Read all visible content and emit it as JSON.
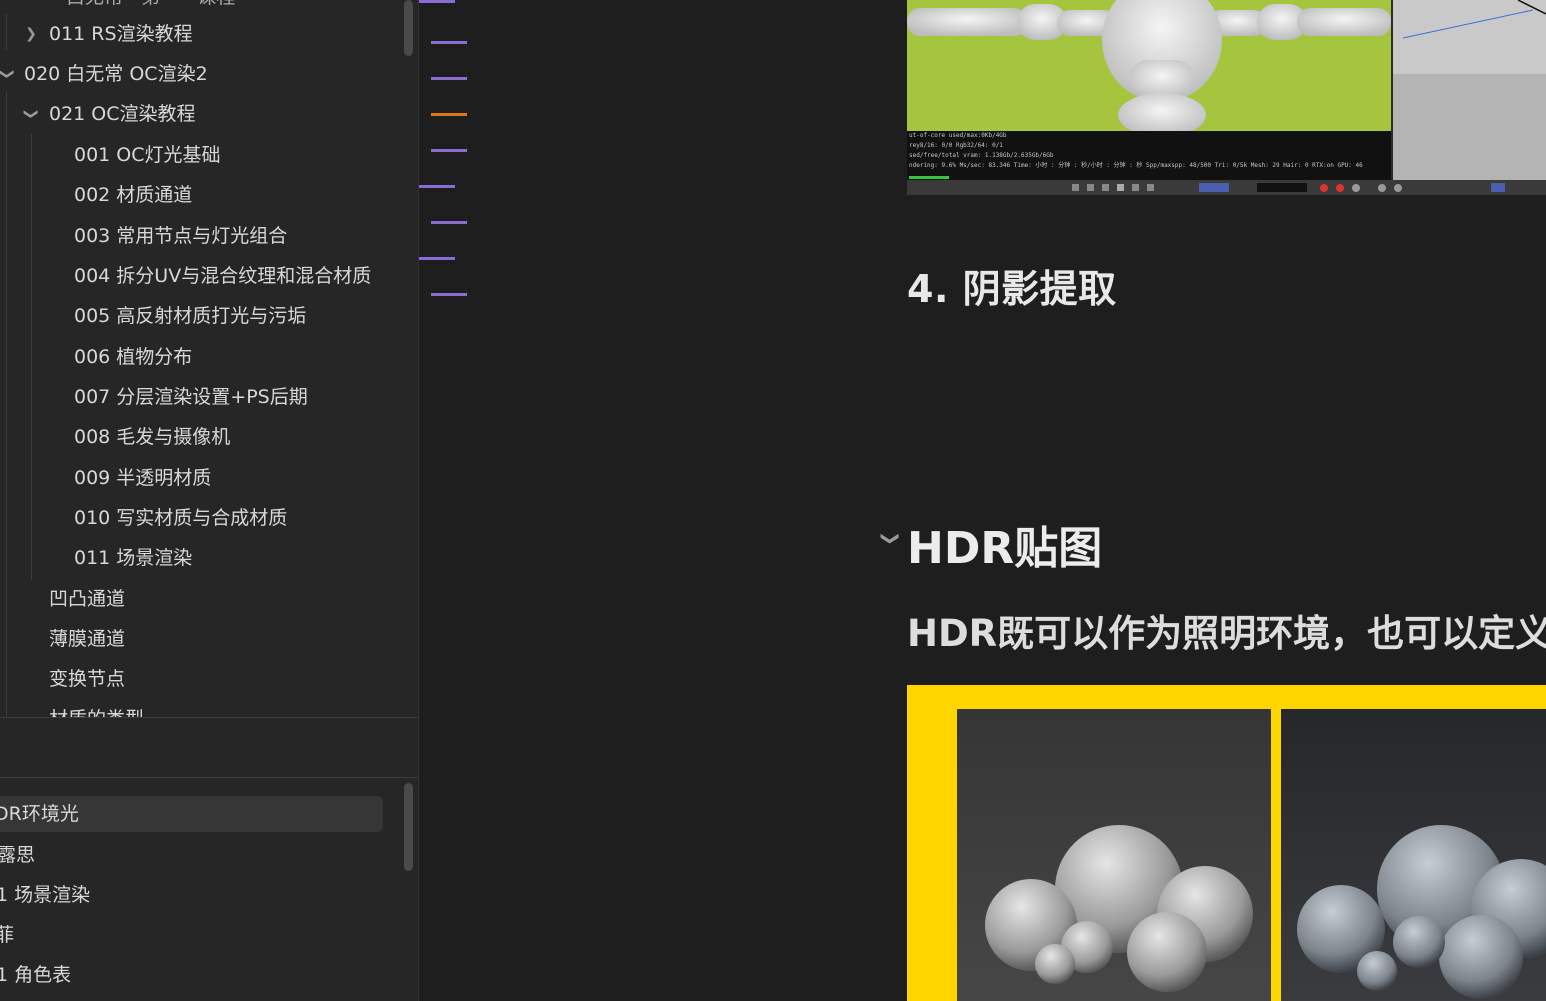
{
  "sidebar": {
    "tree": {
      "top_partial": "白无常 · 第一 · 课程",
      "items": [
        {
          "label": "011  RS渲染教程"
        },
        {
          "label": "020 白无常 OC渲染2"
        },
        {
          "label": "021 OC渲染教程"
        },
        {
          "label": "001 OC灯光基础"
        },
        {
          "label": "002 材质通道"
        },
        {
          "label": "003 常用节点与灯光组合"
        },
        {
          "label": "004 拆分UV与混合纹理和混合材质"
        },
        {
          "label": "005 高反射材质打光与污垢"
        },
        {
          "label": "006 植物分布"
        },
        {
          "label": "007 分层渲染设置+PS后期"
        },
        {
          "label": "008 毛发与摄像机"
        },
        {
          "label": "009 半透明材质"
        },
        {
          "label": "010 写实材质与合成材质"
        },
        {
          "label": "011 场景渲染"
        },
        {
          "label": "凹凸通道"
        },
        {
          "label": "薄膜通道"
        },
        {
          "label": "变换节点"
        },
        {
          "label": "材质的类型"
        }
      ]
    },
    "bookmarks": [
      {
        "label": "DR环境光"
      },
      {
        "label": "露思"
      },
      {
        "label": "1 场景渲染"
      },
      {
        "label": "菲"
      },
      {
        "label": "1 角色表"
      }
    ]
  },
  "content": {
    "render_stats": [
      "ut-of-core used/max:0Kb/4Gb",
      "rey8/16: 0/0          Rgb32/64: 0/1",
      "sed/free/total vram: 1.138Gb/2.635Gb/6Gb",
      "ndering: 9.6%   Ms/sec: 83.346   Time: 小时 : 分钟 : 秒/小时 : 分钟 : 秒   Spp/maxspp: 48/500   Tri: 0/5k   Mesh: 29   Hair: 0   RTX:on   GPU: 46"
    ],
    "section4_heading": "4. 阴影提取",
    "hdr_heading": "HDR贴图",
    "hdr_paragraph": "HDR既可以作为照明环境，也可以定义"
  },
  "colors": {
    "sidebar_bg": "#262626",
    "content_bg": "#1e1e1e",
    "minimap_purple": "#8b6cd6",
    "minimap_orange": "#d9771f",
    "figure_yellow": "#ffd500",
    "viewport_green": "#a5c53e"
  },
  "icons": [
    "chevron-right-icon",
    "chevron-down-icon"
  ]
}
